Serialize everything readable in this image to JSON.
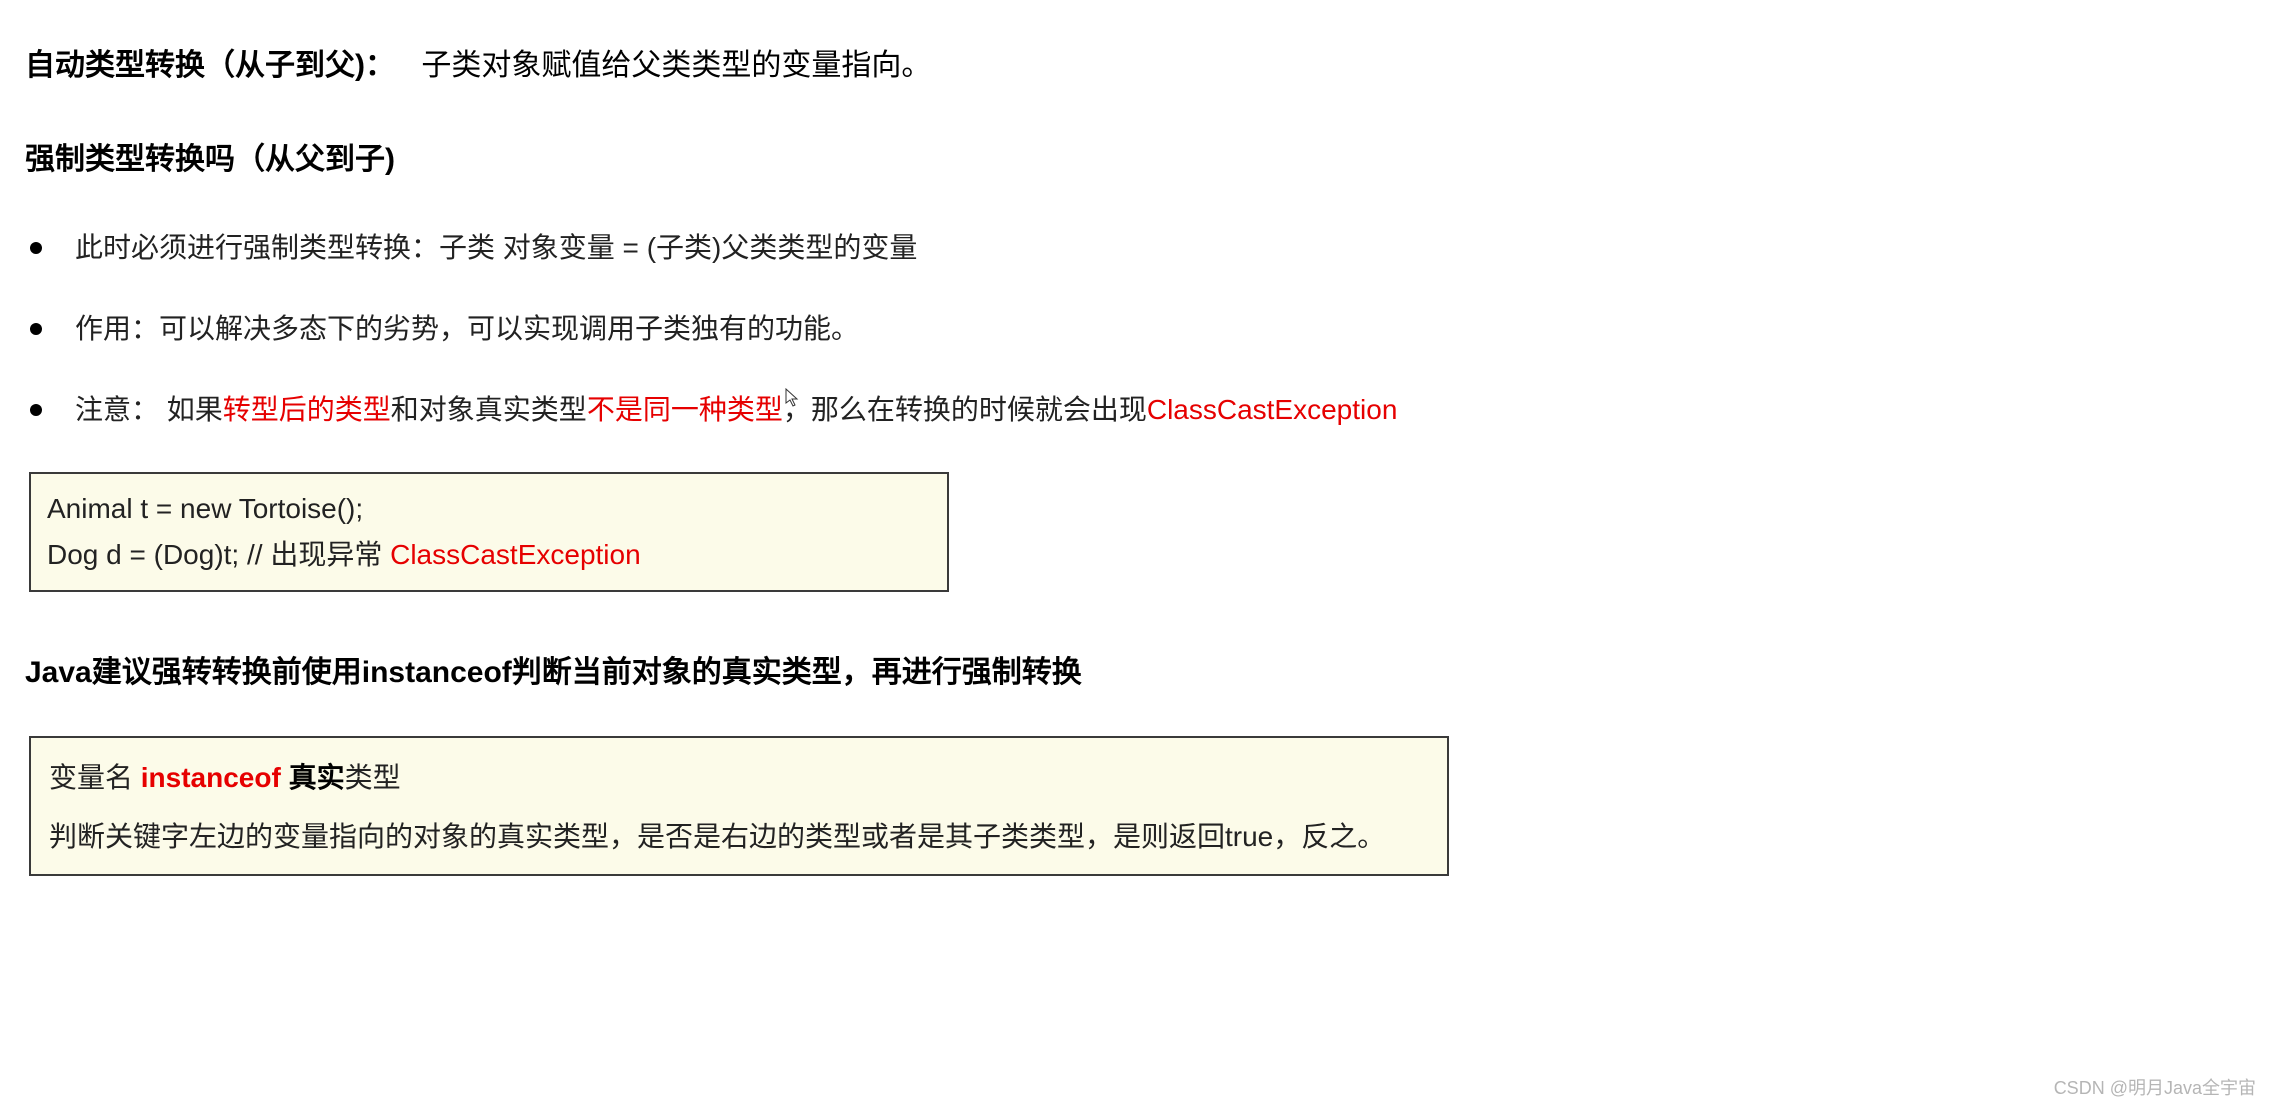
{
  "section1": {
    "heading": "自动类型转换（从子到父)：",
    "desc": "子类对象赋值给父类类型的变量指向。"
  },
  "section2": {
    "heading": "强制类型转换吗（从父到子)",
    "bullets": [
      {
        "text": "此时必须进行强制类型转换：子类 对象变量 = (子类)父类类型的变量"
      },
      {
        "text": "作用：可以解决多态下的劣势，可以实现调用子类独有的功能。"
      },
      {
        "prefix": "注意： 如果",
        "red1": "转型后的类型",
        "mid1": "和对象真实类型",
        "red2": "不是同一种类型",
        "mid2": "，那么在转换的时候就会出现",
        "red3": "ClassCastException"
      }
    ]
  },
  "codebox": {
    "line1": "Animal t = new Tortoise();",
    "line2_prefix": "Dog d = (Dog)t; // 出现异常 ",
    "line2_red": "ClassCastException"
  },
  "section3": {
    "heading": "Java建议强转转换前使用instanceof判断当前对象的真实类型，再进行强制转换"
  },
  "infobox": {
    "line1_prefix": "变量名 ",
    "line1_red": "instanceof ",
    "line1_bold": "真实",
    "line1_suffix": "类型",
    "line2": "判断关键字左边的变量指向的对象的真实类型，是否是右边的类型或者是其子类类型，是则返回true，反之。"
  },
  "watermark": "CSDN @明月Java全宇宙"
}
